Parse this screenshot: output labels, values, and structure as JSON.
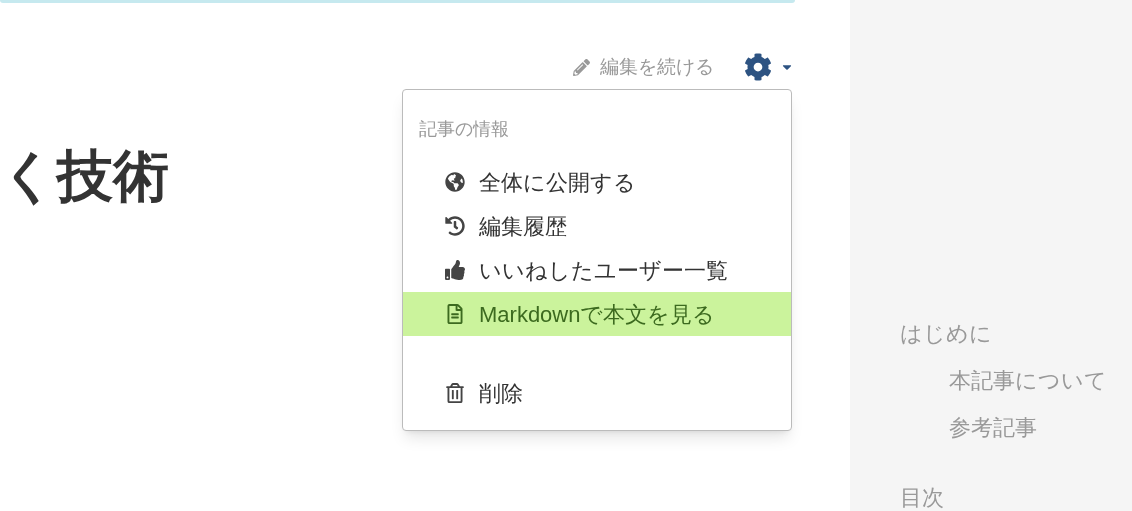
{
  "article": {
    "title": "く技術"
  },
  "toolbar": {
    "edit_link": "編集を続ける"
  },
  "menu": {
    "header": "記事の情報",
    "items": [
      {
        "kind": "globe",
        "label": "全体に公開する",
        "selected": false
      },
      {
        "kind": "history",
        "label": "編集履歴",
        "selected": false
      },
      {
        "kind": "like",
        "label": "いいねしたユーザー一覧",
        "selected": false
      },
      {
        "kind": "file",
        "label": "Markdownで本文を見る",
        "selected": true
      },
      {
        "kind": "trash",
        "label": "削除",
        "selected": false
      }
    ]
  },
  "sidebar": {
    "toc": [
      {
        "label": "はじめに",
        "children": [
          {
            "label": "本記事について"
          },
          {
            "label": "参考記事"
          }
        ]
      },
      {
        "label": "目次"
      }
    ]
  }
}
